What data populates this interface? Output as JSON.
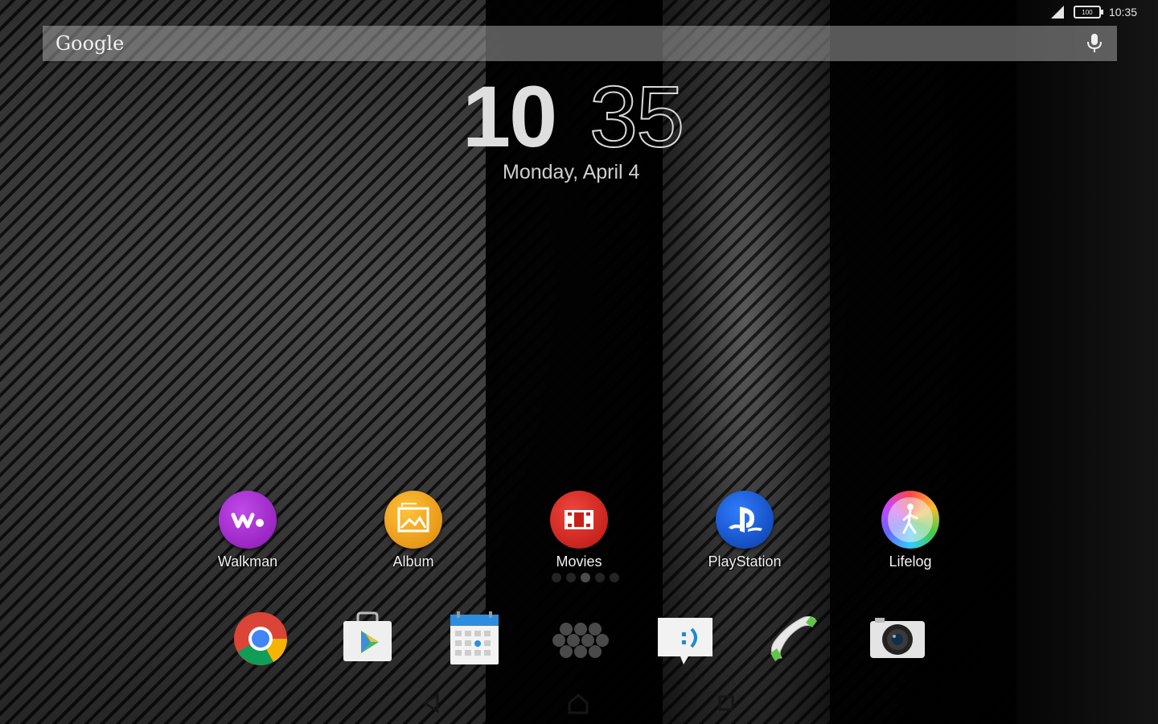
{
  "status_bar": {
    "battery_text": "100",
    "time": "10:35",
    "icons": [
      "signal-icon",
      "battery-icon"
    ]
  },
  "search": {
    "logo_text": "Google",
    "mic_icon": "microphone-icon"
  },
  "clock": {
    "hours": "10",
    "minutes": "35",
    "date": "Monday, April 4"
  },
  "apps": [
    {
      "label": "Walkman",
      "icon": "walkman-icon",
      "color": "#9b1fc4"
    },
    {
      "label": "Album",
      "icon": "album-icon",
      "color": "#e8960e"
    },
    {
      "label": "Movies",
      "icon": "movies-icon",
      "color": "#d3201c"
    },
    {
      "label": "PlayStation",
      "icon": "playstation-icon",
      "color": "#0f4fc8"
    },
    {
      "label": "Lifelog",
      "icon": "lifelog-icon",
      "color": "#b9b9b9"
    }
  ],
  "page_indicator": {
    "count": 5,
    "active": 2
  },
  "dock": [
    {
      "name": "chrome-icon"
    },
    {
      "name": "play-store-icon"
    },
    {
      "name": "calendar-icon"
    },
    {
      "name": "app-drawer-icon"
    },
    {
      "name": "messaging-icon"
    },
    {
      "name": "phone-icon"
    },
    {
      "name": "camera-icon"
    }
  ],
  "nav_bar": [
    "back-icon",
    "home-icon",
    "recents-icon"
  ]
}
